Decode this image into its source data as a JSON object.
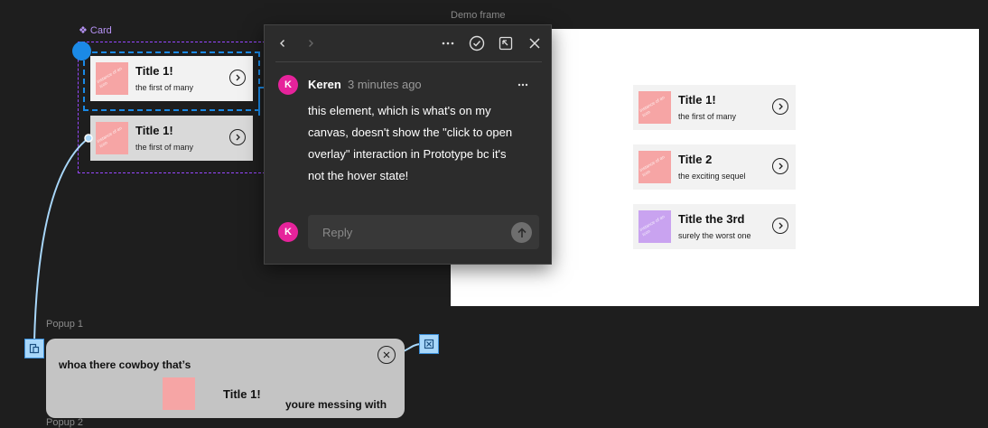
{
  "canvas": {
    "card_component_label": "❖ Card",
    "demo_frame_label": "Demo frame",
    "popup1_label": "Popup 1",
    "popup2_label": "Popup 2",
    "thumb_text": "instance of an icon"
  },
  "component_cards": [
    {
      "title": "Title 1!",
      "subtitle": "the first of many"
    },
    {
      "title": "Title 1!",
      "subtitle": "the first of many"
    }
  ],
  "demo_cards": [
    {
      "title": "Title 1!",
      "subtitle": "the first of many",
      "thumb_color": "#f6a5a5"
    },
    {
      "title": "Title 2",
      "subtitle": "the exciting sequel",
      "thumb_color": "#f6a5a5"
    },
    {
      "title": "Title the 3rd",
      "subtitle": "surely the worst one",
      "thumb_color": "#c9a3f0"
    }
  ],
  "comment": {
    "author": "Keren",
    "avatar_initial": "K",
    "time": "3 minutes ago",
    "body": "this element, which is what's on my canvas, doesn't show the \"click to open overlay\" interaction in Prototype bc it's not the hover state!",
    "reply_placeholder": "Reply",
    "avatar_color": "#e6239b"
  },
  "popup": {
    "line1": "whoa there cowboy that’s",
    "title": "Title 1!",
    "line2": "youre messing with"
  },
  "colors": {
    "selection": "#1b8ae6",
    "component_purple": "#9747ff",
    "prototype_line": "#a8d7fa",
    "canvas_bg": "#1e1e1e"
  }
}
